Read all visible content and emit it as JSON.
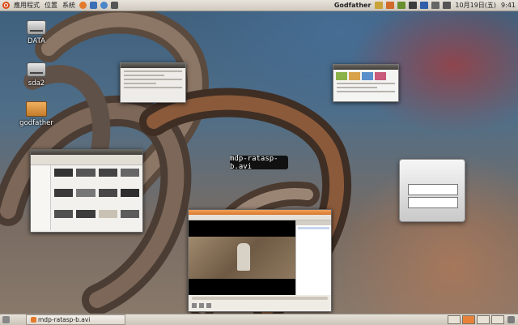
{
  "top_panel": {
    "menus": [
      "應用程式",
      "位置",
      "系統"
    ],
    "user": "Godfather",
    "date": "10月19日(五)",
    "time": "9:41"
  },
  "desktop": {
    "icons": [
      {
        "label": "DATA",
        "kind": "drive-icon"
      },
      {
        "label": "sda2",
        "kind": "drive-icon"
      },
      {
        "label": "godfather",
        "kind": "folder-icon"
      }
    ]
  },
  "tooltip": "mdp-ratasp-b.avi",
  "taskbar": {
    "item_label": "mdp-ratasp-b.avi",
    "workspaces": 4
  },
  "colors": {
    "panel": "#d8d3ca",
    "accent": "#e8823a",
    "ubuntu": "#dd4814"
  }
}
